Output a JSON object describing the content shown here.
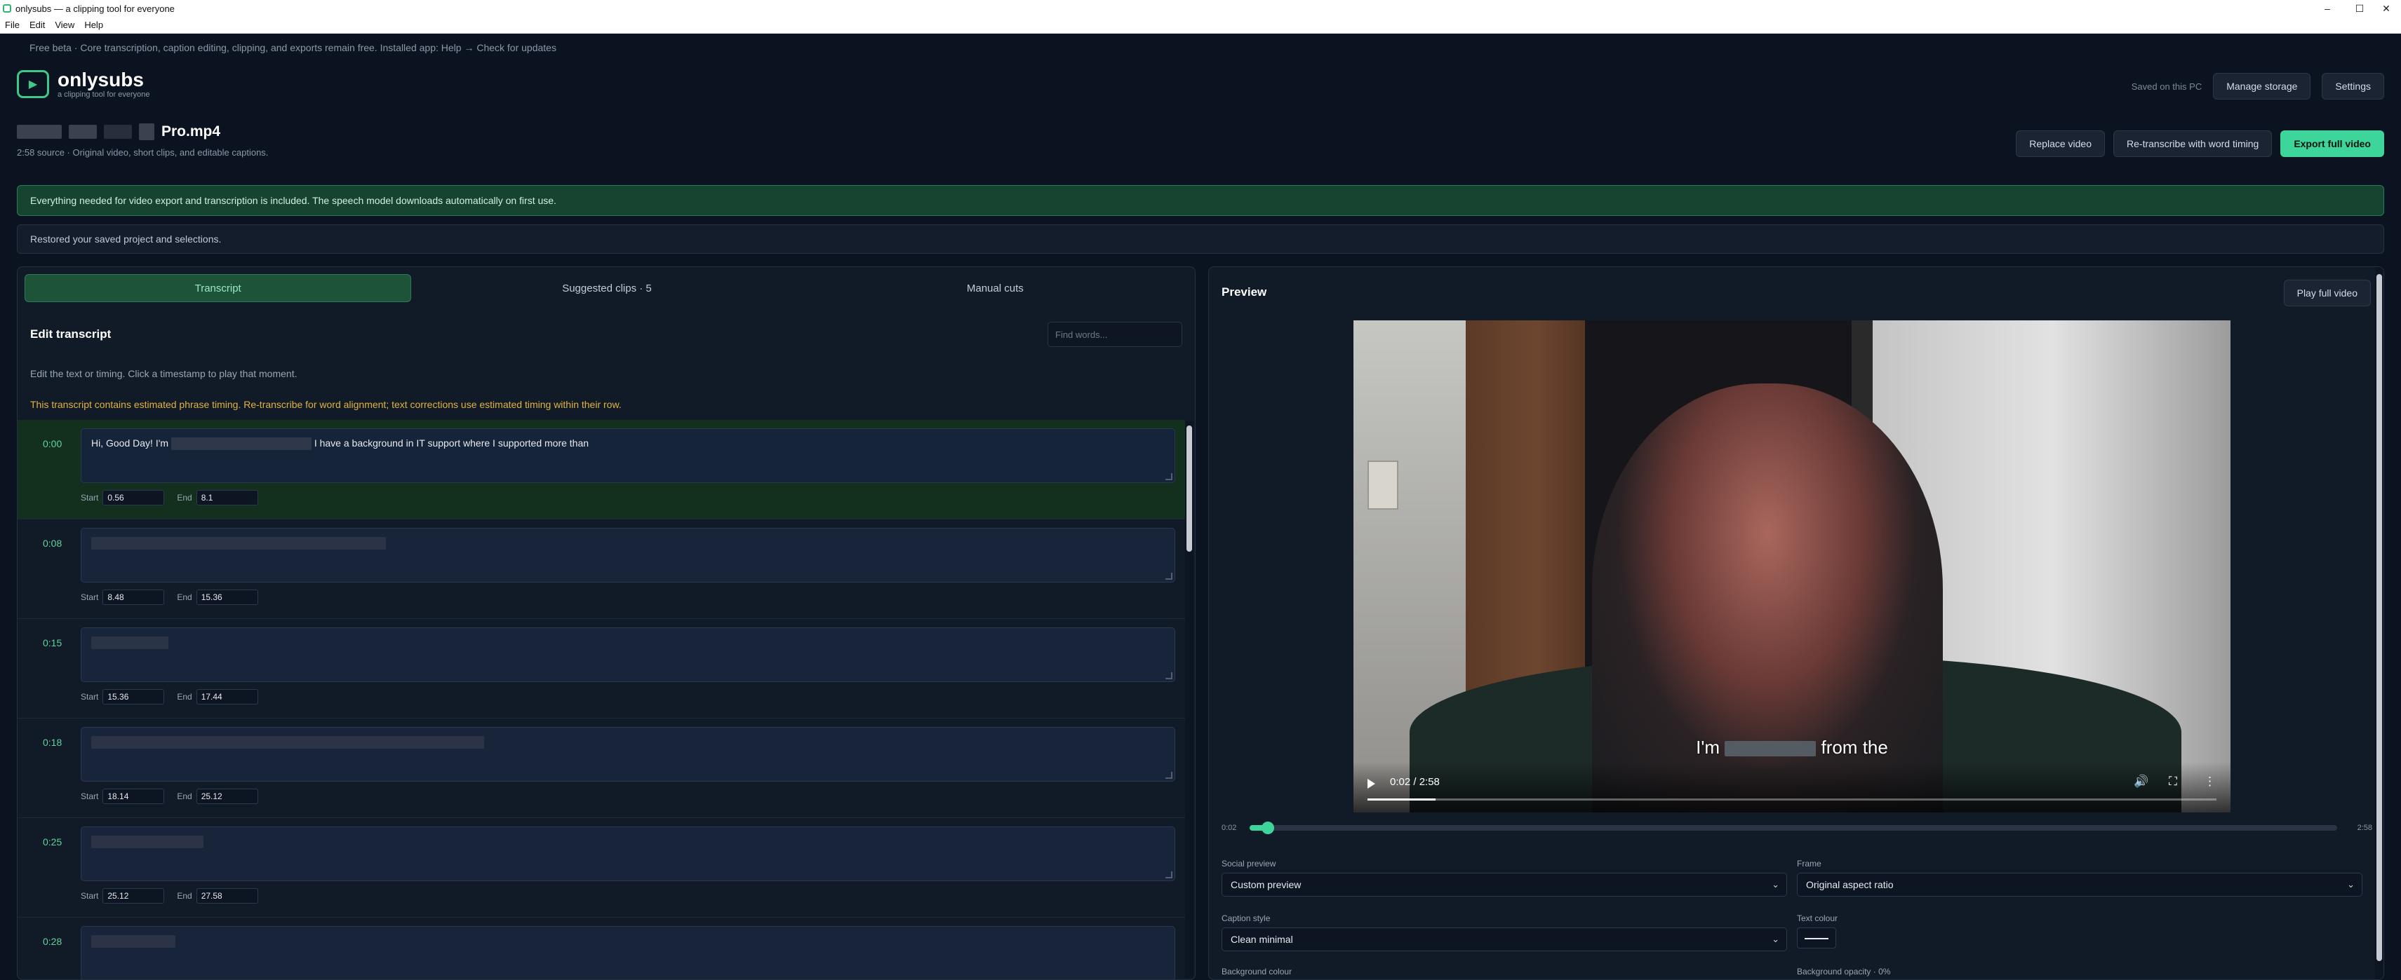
{
  "window": {
    "title": "onlysubs — a clipping tool for everyone",
    "controls": {
      "minimize": "–",
      "maximize": "☐",
      "close": "✕"
    }
  },
  "menu": [
    "File",
    "Edit",
    "View",
    "Help"
  ],
  "beta_banner": "Free beta · Core transcription, caption editing, clipping, and exports remain free. Installed app: Help → Check for updates",
  "brand": {
    "name": "onlysubs",
    "tagline": "a clipping tool for everyone"
  },
  "header": {
    "saved_status": "Saved on this PC",
    "manage_storage": "Manage storage",
    "settings": "Settings"
  },
  "file": {
    "name_suffix": "Pro.mp4",
    "subtitle": "2:58 source · Original video, short clips, and editable captions.",
    "replace_video": "Replace video",
    "retranscribe": "Re-transcribe with word timing",
    "export": "Export full video"
  },
  "notices": {
    "included": "Everything needed for video export and transcription is included. The speech model downloads automatically on first use.",
    "restored": "Restored your saved project and selections."
  },
  "tabs": [
    "Transcript",
    "Suggested clips · 5",
    "Manual cuts"
  ],
  "editor": {
    "title": "Edit transcript",
    "find_placeholder": "Find words...",
    "hint": "Edit the text or timing. Click a timestamp to play that moment.",
    "warning": "This transcript contains estimated phrase timing. Re-transcribe for word alignment; text corrections use estimated timing within their row.",
    "start_label": "Start",
    "end_label": "End"
  },
  "rows": [
    {
      "ts": "0:00",
      "text_a": "Hi, Good Day! I'm",
      "text_b": "I have a background in IT support where I supported more than",
      "start": "0.56",
      "end": "8.1",
      "active": true
    },
    {
      "ts": "0:08",
      "text_a": "",
      "text_b": "",
      "start": "8.48",
      "end": "15.36"
    },
    {
      "ts": "0:15",
      "text_a": "",
      "text_b": "",
      "start": "15.36",
      "end": "17.44"
    },
    {
      "ts": "0:18",
      "text_a": "",
      "text_b": "",
      "start": "18.14",
      "end": "25.12"
    },
    {
      "ts": "0:25",
      "text_a": "",
      "text_b": "",
      "start": "25.12",
      "end": "27.58"
    },
    {
      "ts": "0:28",
      "text_a": "",
      "text_b": "",
      "start": "",
      "end": ""
    }
  ],
  "preview": {
    "title": "Preview",
    "play_full": "Play full video",
    "caption_a": "I'm",
    "caption_b": "from the",
    "player_time": "0:02 / 2:58",
    "scrub_start": "0:02",
    "scrub_end": "2:58",
    "progress": 0.011
  },
  "settings": {
    "social_preview_label": "Social preview",
    "social_preview_value": "Custom preview",
    "frame_label": "Frame",
    "frame_value": "Original aspect ratio",
    "caption_style_label": "Caption style",
    "caption_style_value": "Clean minimal",
    "text_colour_label": "Text colour",
    "background_colour_label": "Background colour",
    "background_opacity_label": "Background opacity · 0%"
  },
  "colors": {
    "accent": "#3ed59a",
    "bg": "#0c1320",
    "panel": "#111a27",
    "warning": "#e0b341"
  }
}
